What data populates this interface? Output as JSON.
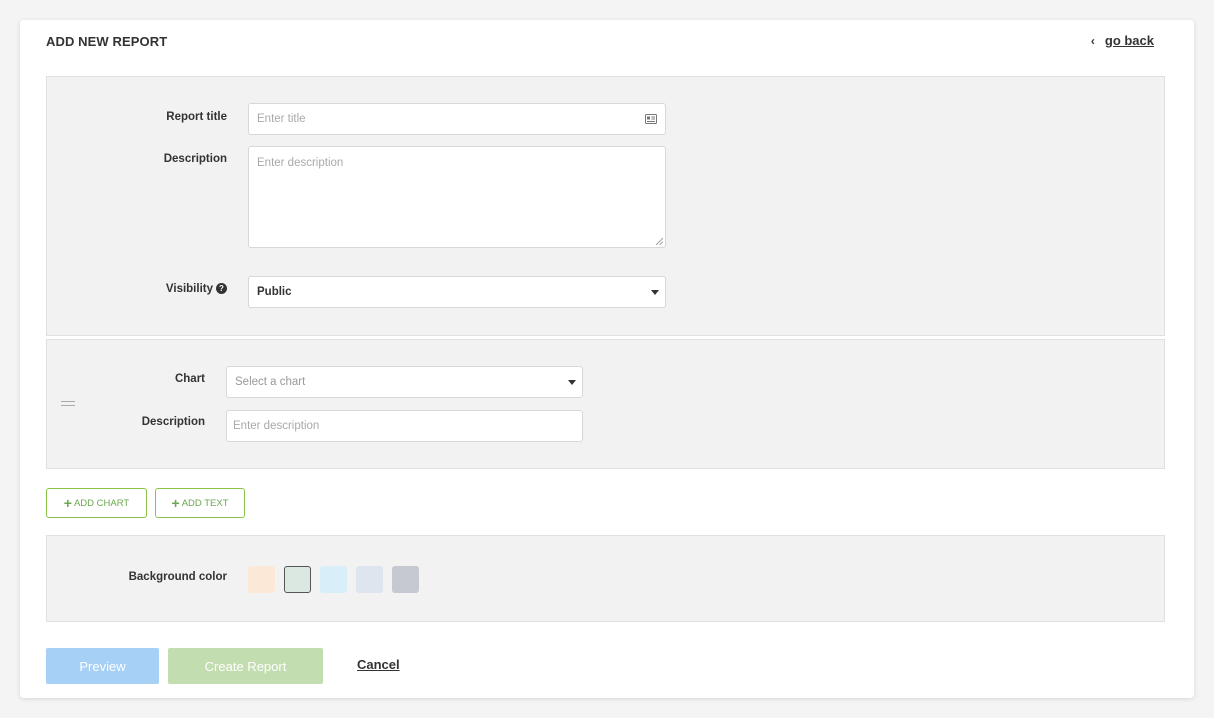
{
  "header": {
    "title": "ADD NEW REPORT",
    "go_back_label": "go back"
  },
  "report_form": {
    "title_label": "Report title",
    "title_placeholder": "Enter title",
    "description_label": "Description",
    "description_placeholder": "Enter description",
    "visibility_label": "Visibility",
    "visibility_value": "Public"
  },
  "chart_block": {
    "chart_label": "Chart",
    "chart_placeholder": "Select a chart",
    "description_label": "Description",
    "description_placeholder": "Enter description"
  },
  "actions": {
    "add_chart_label": "ADD CHART",
    "add_text_label": "ADD TEXT"
  },
  "background": {
    "label": "Background color",
    "swatches": [
      "#fbe8d6",
      "#dbe8e1",
      "#d8eef8",
      "#dde5ef",
      "#c6c8d2"
    ],
    "selected_index": 1
  },
  "footer": {
    "preview_label": "Preview",
    "create_label": "Create Report",
    "cancel_label": "Cancel"
  },
  "colors": {
    "accent_green": "#8bc34a",
    "preview_blue": "#a6d0f5",
    "create_green": "#c2ddb0"
  }
}
